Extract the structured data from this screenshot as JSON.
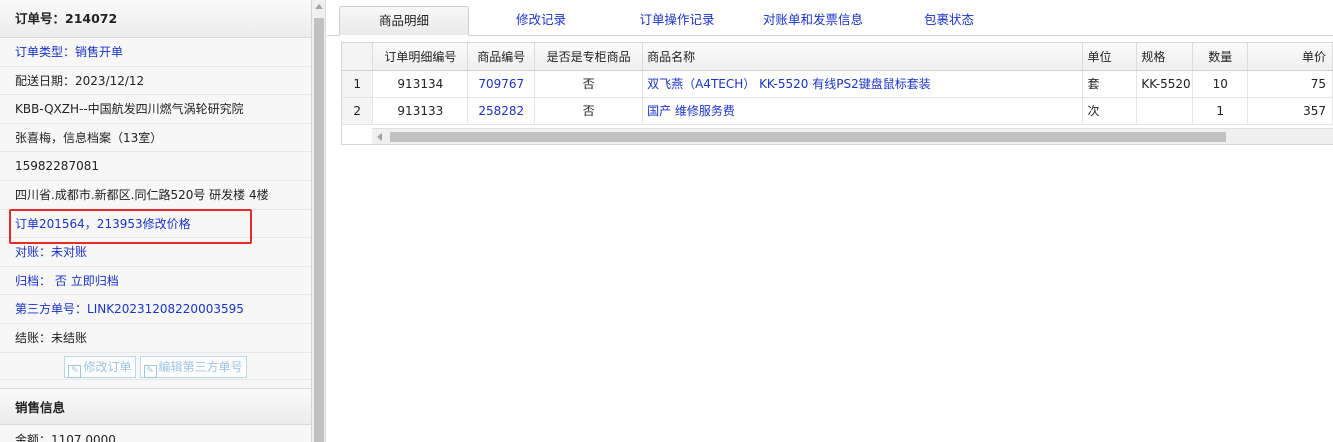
{
  "order": {
    "number_label": "订单号：",
    "number": "214072",
    "type_label": "订单类型：",
    "type": "销售开单",
    "delivery_date": "配送日期：2023/12/12",
    "customer": "KBB-QXZH--中国航发四川燃气涡轮研究院",
    "contact": "张喜梅，信息档案（13室）",
    "phone": "15982287081",
    "address": "四川省.成都市.新都区.同仁路520号 研发楼 4楼",
    "remark": "订单201564，213953修改价格",
    "reconcile_label": "对账：",
    "reconcile": "未对账",
    "archive_label": "归档：",
    "archive_value": "否",
    "archive_action": "立即归档",
    "third_party_label": "第三方单号：",
    "third_party": "LINK20231208220003595",
    "settle": "结账：未结账",
    "buttons": {
      "edit_order": "修改订单",
      "edit_third_party": "编辑第三方单号"
    }
  },
  "sales_info": {
    "title": "销售信息",
    "amount": "金额：1107.0000"
  },
  "tabs": [
    {
      "label": "商品明细",
      "active": true
    },
    {
      "label": "修改记录",
      "active": false
    },
    {
      "label": "订单操作记录",
      "active": false
    },
    {
      "label": "对账单和发票信息",
      "active": false
    },
    {
      "label": "包裹状态",
      "active": false
    }
  ],
  "grid": {
    "columns": [
      "订单明细编号",
      "商品编号",
      "是否是专柜商品",
      "商品名称",
      "单位",
      "规格",
      "数量",
      "单价"
    ],
    "rows": [
      {
        "rownum": "1",
        "detail_id": "913134",
        "product_id": "709767",
        "counter": "否",
        "name": "双飞燕（A4TECH） KK-5520 有线PS2键盘鼠标套装",
        "unit": "套",
        "spec": "KK-5520",
        "qty": "10",
        "price": "75"
      },
      {
        "rownum": "2",
        "detail_id": "913133",
        "product_id": "258282",
        "counter": "否",
        "name": "国产 维修服务费",
        "unit": "次",
        "spec": "",
        "qty": "1",
        "price": "357"
      }
    ]
  },
  "colors": {
    "link": "#1a33c8",
    "highlight": "#e82a2a",
    "ghost_button": "#9fc4e4"
  }
}
